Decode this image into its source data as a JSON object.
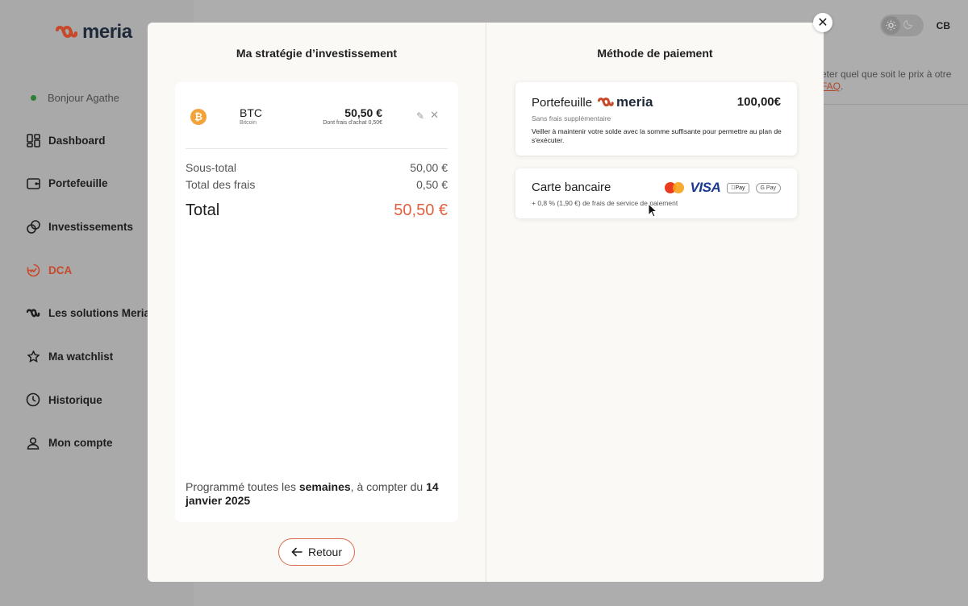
{
  "app": {
    "brand": "meria",
    "accent_color": "#e0613f",
    "brand_icon": "meria-logo-icon"
  },
  "sidebar": {
    "greeting": "Bonjour Agathe",
    "items": [
      {
        "label": "Dashboard",
        "icon": "dashboard-icon"
      },
      {
        "label": "Portefeuille",
        "icon": "wallet-icon"
      },
      {
        "label": "Investissements",
        "icon": "investments-icon"
      },
      {
        "label": "DCA",
        "icon": "dca-icon",
        "active": true
      },
      {
        "label": "Les solutions Meria",
        "icon": "meria-solutions-icon"
      },
      {
        "label": "Ma watchlist",
        "icon": "star-icon"
      },
      {
        "label": "Historique",
        "icon": "history-icon"
      },
      {
        "label": "Mon compte",
        "icon": "user-icon"
      }
    ]
  },
  "header": {
    "user_initials": "CB",
    "theme": "light"
  },
  "background_hint": {
    "text": "eter quel que soit le prix à otre",
    "link": "FAQ",
    "suffix": "."
  },
  "modal": {
    "strategy": {
      "title": "Ma stratégie d’investissement",
      "asset": {
        "symbol": "BTC",
        "name": "Bitcoin",
        "amount": "50,50 €",
        "fee_note": "Dont frais d'achat 0,50€"
      },
      "subtotal_label": "Sous-total",
      "subtotal_value": "50,00 €",
      "fees_label": "Total des frais",
      "fees_value": "0,50 €",
      "total_label": "Total",
      "total_value": "50,50 €",
      "schedule": {
        "prefix": "Programmé toutes les ",
        "frequency": "semaines",
        "middle": ", à compter du ",
        "date": "14 janvier 2025"
      },
      "back_label": "Retour"
    },
    "payment": {
      "title": "Méthode de paiement",
      "wallet": {
        "label": "Portefeuille",
        "brand": "meria",
        "balance": "100,00€",
        "subtitle": "Sans frais supplémentaire",
        "note": "Veiller à maintenir votre solde avec la somme suffisante pour permettre au plan de s'exécuter."
      },
      "card": {
        "label": "Carte bancaire",
        "fee_note": "+ 0,8 % (1,90 €) de frais de service de paiement",
        "brands": [
          "Mastercard",
          "VISA",
          "Apple Pay",
          "G Pay"
        ]
      }
    }
  }
}
